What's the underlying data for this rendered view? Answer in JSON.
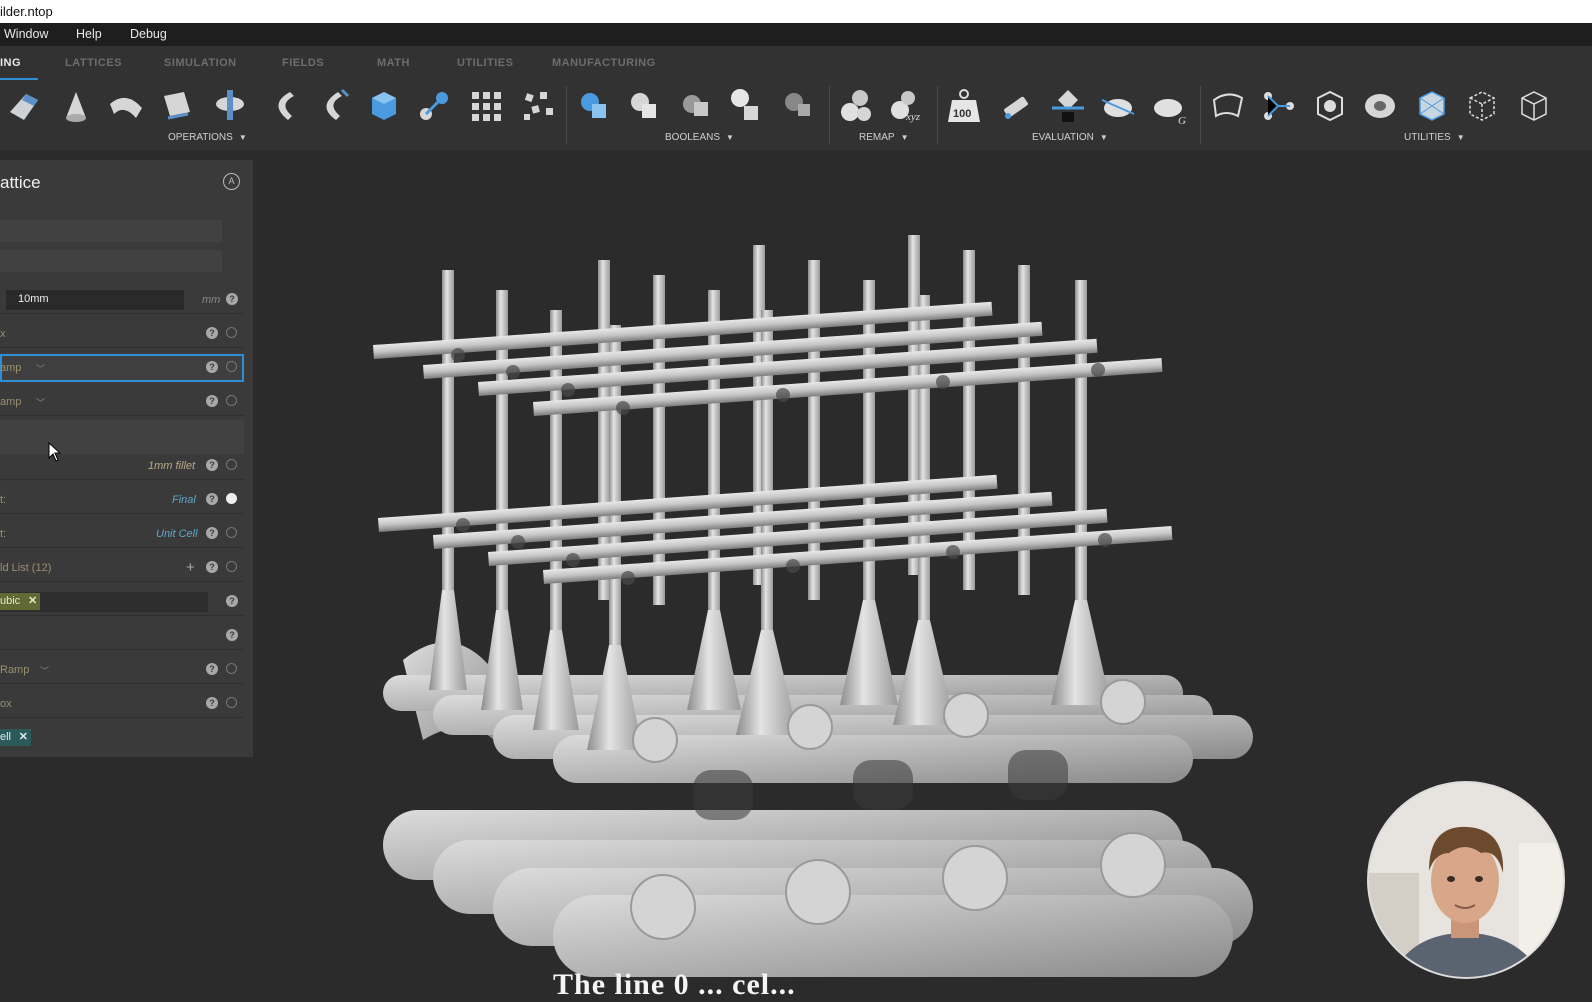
{
  "window": {
    "title": "ilder.ntop"
  },
  "menu": {
    "items": [
      "Window",
      "Help",
      "Debug"
    ]
  },
  "tabs": [
    {
      "label": "ING",
      "active": true
    },
    {
      "label": "LATTICES",
      "active": false
    },
    {
      "label": "SIMULATION",
      "active": false
    },
    {
      "label": "FIELDS",
      "active": false
    },
    {
      "label": "MATH",
      "active": false
    },
    {
      "label": "UTILITIES",
      "active": false
    },
    {
      "label": "MANUFACTURING",
      "active": false
    }
  ],
  "toolbar": {
    "groups": [
      "OPERATIONS",
      "BOOLEANS",
      "REMAP",
      "EVALUATION",
      "UTILITIES"
    ],
    "weight_icon_label": "100",
    "xyz_icon_label": "xyz"
  },
  "panel": {
    "title": "attice",
    "thickness_value": "10mm",
    "thickness_unit": "mm",
    "rows": [
      {
        "label": "x",
        "value": ""
      },
      {
        "label": "amp",
        "value": ""
      },
      {
        "label": "amp",
        "value": ""
      },
      {
        "label": "",
        "value": "1mm fillet"
      },
      {
        "label": "t:",
        "value": "Final"
      },
      {
        "label": "t:",
        "value": "Unit Cell"
      },
      {
        "label": "ld List (12)",
        "value": ""
      },
      {
        "label": "ubic",
        "value": ""
      },
      {
        "label": "",
        "value": ""
      },
      {
        "label": "Ramp",
        "value": ""
      },
      {
        "label": "ox",
        "value": ""
      },
      {
        "label": "ell",
        "value": ""
      }
    ]
  },
  "subtitle": "The line 0 ... cel...",
  "colors": {
    "accent": "#2f8fd6",
    "chip_olive": "#5f6a35",
    "chip_teal": "#2c5a5a"
  }
}
